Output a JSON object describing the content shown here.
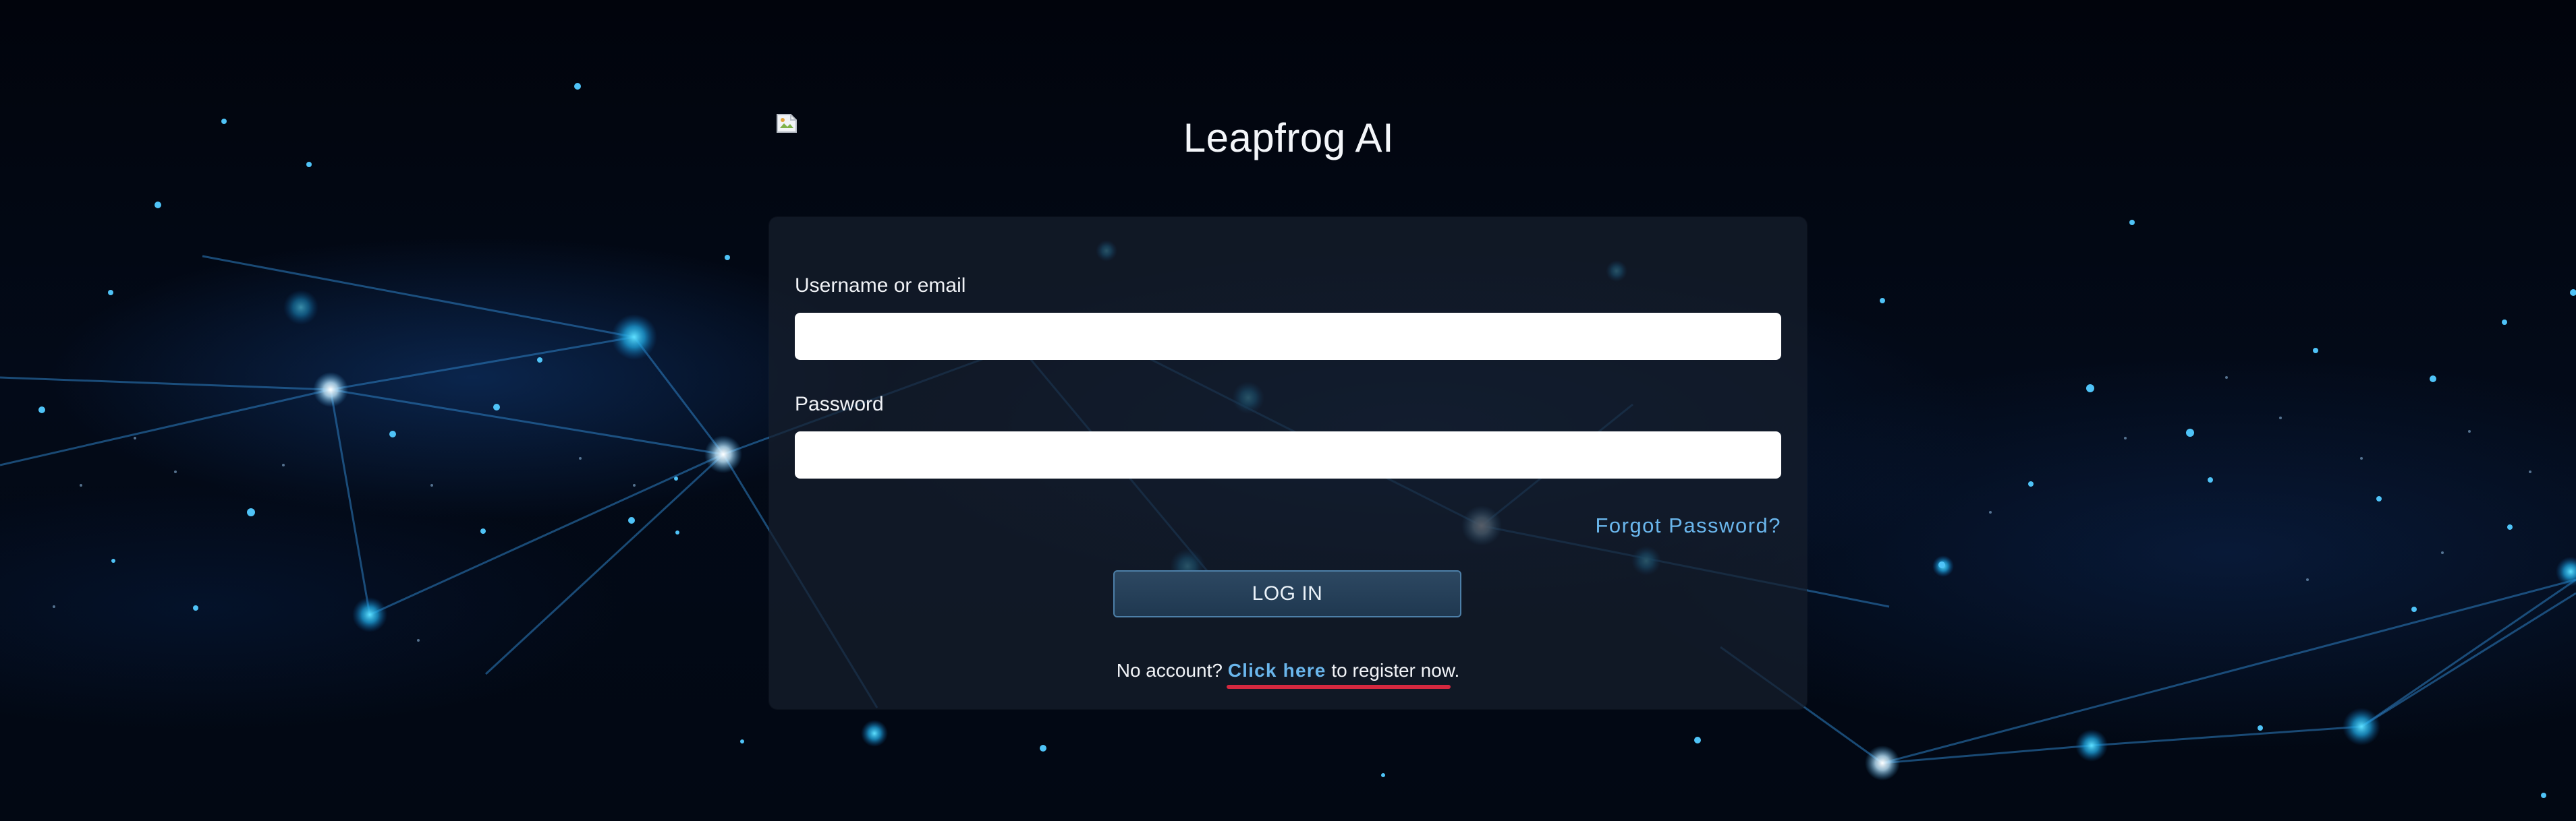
{
  "app": {
    "title": "Leapfrog AI"
  },
  "login_form": {
    "username_label": "Username or email",
    "username_value": "",
    "password_label": "Password",
    "password_value": "",
    "forgot_password_label": "Forgot Password?",
    "login_button_label": "LOG IN",
    "register_prefix": "No account?",
    "register_link_label": "Click here",
    "register_suffix": "to register now."
  },
  "colors": {
    "accent_link": "#6ab6ec",
    "button_border": "#4d7fa8",
    "underline_highlight": "#d5283f",
    "background": "#020611"
  },
  "icons": {
    "logo": "broken-image-icon"
  }
}
